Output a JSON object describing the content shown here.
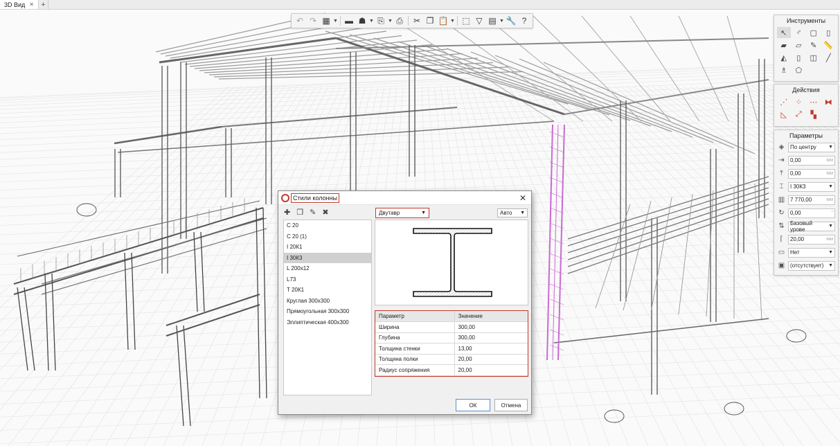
{
  "tabs": [
    {
      "label": "3D Вид"
    }
  ],
  "toolbar": {
    "icons": [
      "undo-icon",
      "redo-icon",
      "view-cube-icon",
      "layers-icon",
      "level-icon",
      "import-icon",
      "print-icon",
      "cut-icon",
      "copy-icon",
      "paste-icon",
      "select-tool-icon",
      "filter-icon",
      "display-settings-icon",
      "wrench-icon",
      "help-icon"
    ]
  },
  "tools_panel": {
    "title": "Инструменты"
  },
  "actions_panel": {
    "title": "Действия"
  },
  "params_panel": {
    "title": "Параметры",
    "anchor": "По центру",
    "offset_x": {
      "value": "0,00",
      "unit": "мм"
    },
    "offset_y": {
      "value": "0,00",
      "unit": "мм"
    },
    "profile": "I 30К3",
    "height": {
      "value": "7 770,00",
      "unit": "мм"
    },
    "rotation": {
      "value": "0,00",
      "unit": "°"
    },
    "base_level": "Базовый урове",
    "base_offset": {
      "value": "20,00",
      "unit": "мм"
    },
    "finish": "Нет",
    "material": "(отсутствует)"
  },
  "dialog": {
    "title": "Стили колонны",
    "close_label": "✕",
    "styles": [
      "С 20",
      "С 20 (1)",
      "I 20К1",
      "I 30К3",
      "L 200x12",
      "L73",
      "Т 20К1",
      "Круглая 300x300",
      "Прямоугольная 300x300",
      "Эллиптическая 400x300"
    ],
    "selected_style": "I 30К3",
    "profile_type": "Двутавр",
    "scale_mode": "Авто",
    "params_headers": {
      "name": "Параметр",
      "value": "Значение"
    },
    "params": [
      {
        "name": "Ширина",
        "value": "300,00"
      },
      {
        "name": "Глубина",
        "value": "300,00"
      },
      {
        "name": "Толщина стенки",
        "value": "13,00"
      },
      {
        "name": "Толщина полки",
        "value": "20,00"
      },
      {
        "name": "Радиус сопряжения",
        "value": "20,00"
      }
    ],
    "ok_label": "ОК",
    "cancel_label": "Отмена"
  },
  "colors": {
    "accent_red": "#c0392b",
    "highlight_magenta": "#c86ad2"
  }
}
